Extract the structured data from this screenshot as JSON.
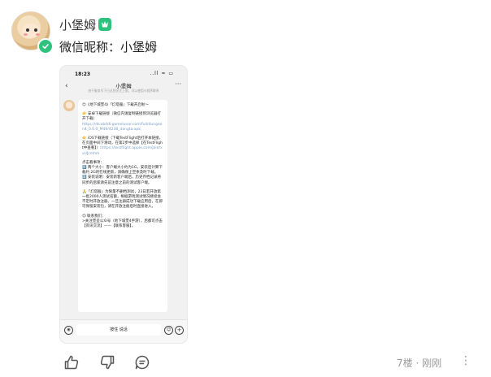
{
  "post": {
    "username": "小堡姆",
    "nickname_line": "微信昵称：小堡姆"
  },
  "phone": {
    "status_time": "18:23",
    "status_icons": "..ll ≈ ▭",
    "chat_title": "小堡姆",
    "chat_subtitle": "由于服务号下已达到关注上限，可以使用小程序联系",
    "message": {
      "p1": "😊《地下城堡4》「灯塔服」下载开启啦～",
      "p2": "👉 安卓下载链接（微信内请复制链接到浏览器打开下载）",
      "p2_url": "https://dlcxbddl.gamelunar.com/full/dungeon4_0.6.0_M49/4238_dangta.apk",
      "p3": "👉 iOS下载链接（下载TestFlight后打开本链接，在页面中间下滑动，在第2步中选择【在TestFlight中查看】）:",
      "p3_url": "https://testflight.apple.com/join/xvUJcmhm",
      "p4": "点击看事项：\n1️⃣ 两个大小：客户端大小约为1G，安装后计算下载约 2G的在线更新，请确保上空余及时下载。\n2️⃣ 安装说明：安装新客户端后，历史存档记录将同步的后家请先前注意之前的测试客户端。",
      "p5": "🙏「灯塔服」为限量不删档测试，23日若开放第一批2000人测试名额，根据游戏测试情况继续会不定时开放注册。一旦注册成功下载应用后，在即可保留安装包，请在开放注册后时直接进入。",
      "p6": "😊 联系我们：\n>关注堡垒公众号（地下城堡4手游），后都可点击【资讯交流】——【联系客服】。"
    },
    "input_placeholder": "按住 说话"
  },
  "footer": {
    "meta": "7楼 · 刚刚"
  },
  "colors": {
    "accent_green": "#2ec27e",
    "link_blue": "#7a9cc6",
    "muted_gray": "#999999"
  }
}
